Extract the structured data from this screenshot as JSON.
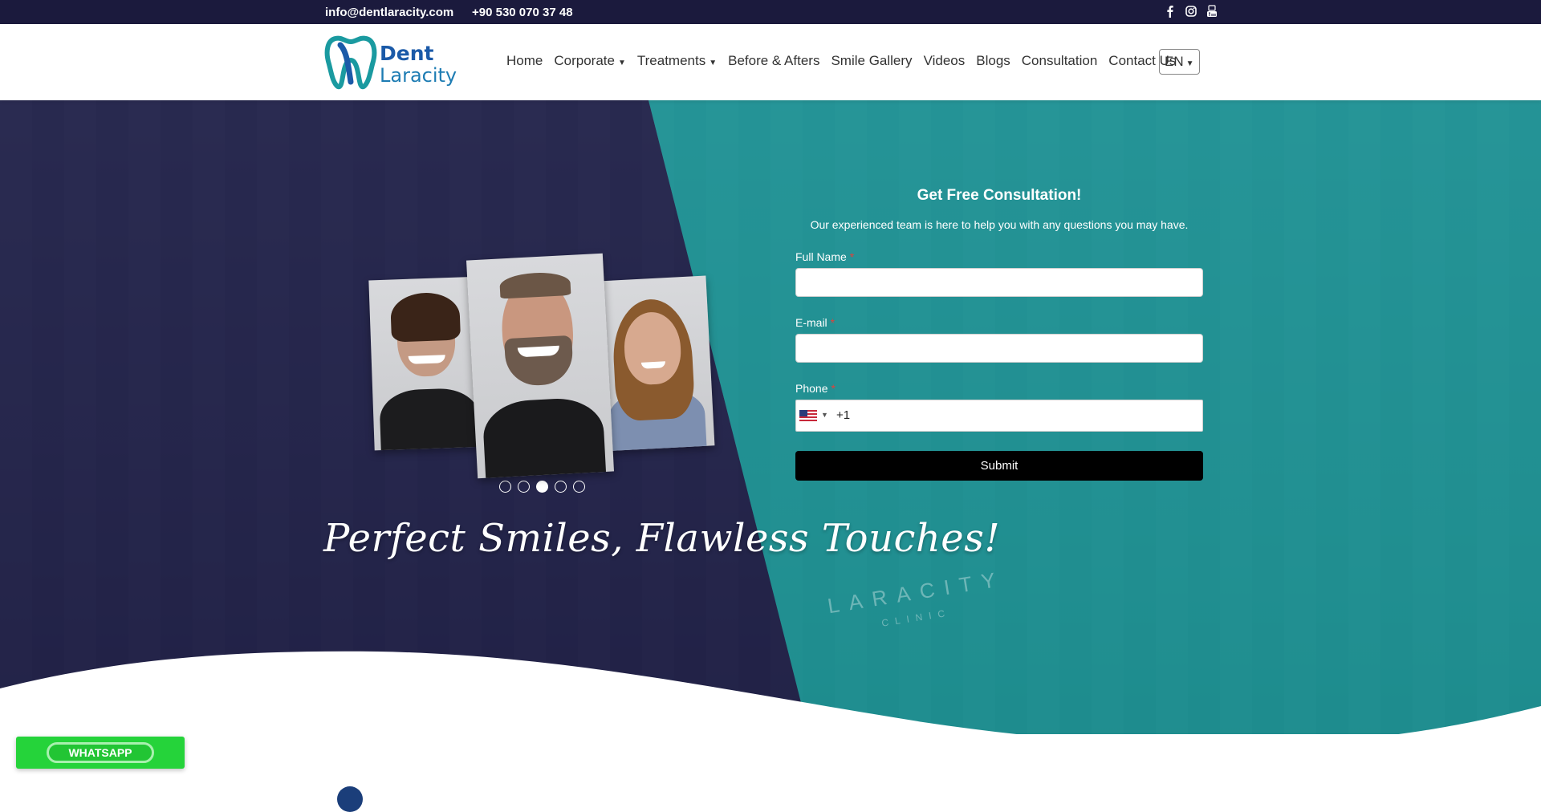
{
  "topbar": {
    "email": "info@dentlaracity.com",
    "phone": "+90 530 070 37 48",
    "socials": [
      "facebook-icon",
      "instagram-icon",
      "youtube-icon"
    ]
  },
  "header": {
    "logo": {
      "word1": "Dent",
      "word2": "Laracity"
    },
    "nav": [
      {
        "label": "Home",
        "dropdown": false
      },
      {
        "label": "Corporate",
        "dropdown": true
      },
      {
        "label": "Treatments",
        "dropdown": true
      },
      {
        "label": "Before & Afters",
        "dropdown": false
      },
      {
        "label": "Smile Gallery",
        "dropdown": false
      },
      {
        "label": "Videos",
        "dropdown": false
      },
      {
        "label": "Blogs",
        "dropdown": false
      },
      {
        "label": "Consultation",
        "dropdown": false
      },
      {
        "label": "Contact Us",
        "dropdown": false
      }
    ],
    "language": "EN",
    "caret": "▼"
  },
  "hero": {
    "slogan": "Perfect Smiles, Flawless Touches!",
    "slider": {
      "total": 5,
      "active": 3
    },
    "watermark": "LARACITY",
    "watermark_sub": "CLINIC"
  },
  "form": {
    "title": "Get Free Consultation!",
    "subtitle": "Our experienced team is here to help you with any questions you may have.",
    "fields": {
      "full_name": {
        "label": "Full Name",
        "required": "*"
      },
      "email": {
        "label": "E-mail",
        "required": "*"
      },
      "phone": {
        "label": "Phone",
        "required": "*",
        "dial_code": "+1",
        "country": "US"
      }
    },
    "submit": "Submit"
  },
  "whatsapp": {
    "label": "WHATSAPP"
  },
  "colors": {
    "topbar": "#1b1a3d",
    "navy_overlay": "#1b1a46",
    "teal_overlay": "#18a0a0",
    "submit": "#000000",
    "whatsapp": "#25d33a"
  }
}
